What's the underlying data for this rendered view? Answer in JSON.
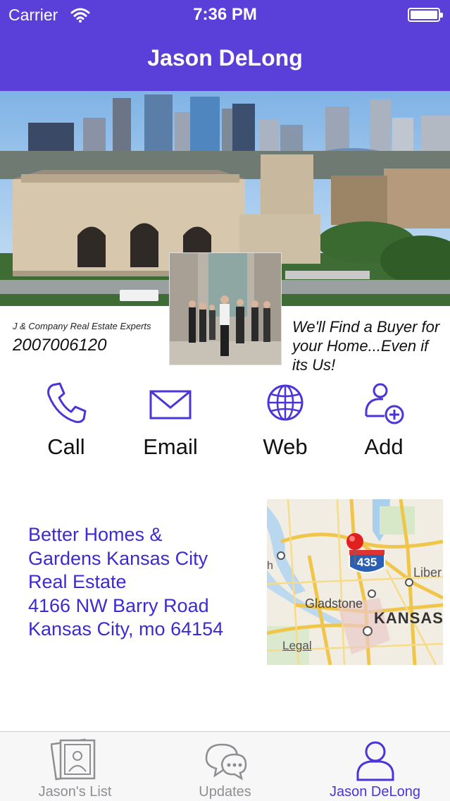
{
  "status_bar": {
    "carrier": "Carrier",
    "time": "7:36 PM"
  },
  "nav": {
    "title": "Jason DeLong"
  },
  "profile": {
    "company": "J & Company Real Estate Experts",
    "phone": "2007006120",
    "slogan": "We'll Find a Buyer for your Home...Even if its Us!"
  },
  "actions": [
    {
      "label": "Call",
      "icon": "phone-icon"
    },
    {
      "label": "Email",
      "icon": "envelope-icon"
    },
    {
      "label": "Web",
      "icon": "globe-icon"
    },
    {
      "label": "Add",
      "icon": "add-contact-icon"
    }
  ],
  "address": {
    "line1": "Better Homes &",
    "line2": "Gardens Kansas City",
    "line3": "Real Estate",
    "line4": "4166 NW Barry Road",
    "line5": "Kansas City, mo 64154"
  },
  "map": {
    "highway": "435",
    "labels": {
      "liberty": "Liber",
      "gladstone": "Gladstone",
      "kansas": "KANSAS",
      "legal": "Legal",
      "h": "h"
    }
  },
  "tabs": [
    {
      "label": "Jason's List",
      "icon": "photos-icon",
      "active": false
    },
    {
      "label": "Updates",
      "icon": "chat-bubbles-icon",
      "active": false
    },
    {
      "label": "Jason DeLong",
      "icon": "person-icon",
      "active": true
    }
  ],
  "colors": {
    "nav_bg": "#5a3fd8",
    "accent": "#4a35d8",
    "address_text": "#3b2bd0",
    "tab_inactive": "#8e8e93"
  }
}
